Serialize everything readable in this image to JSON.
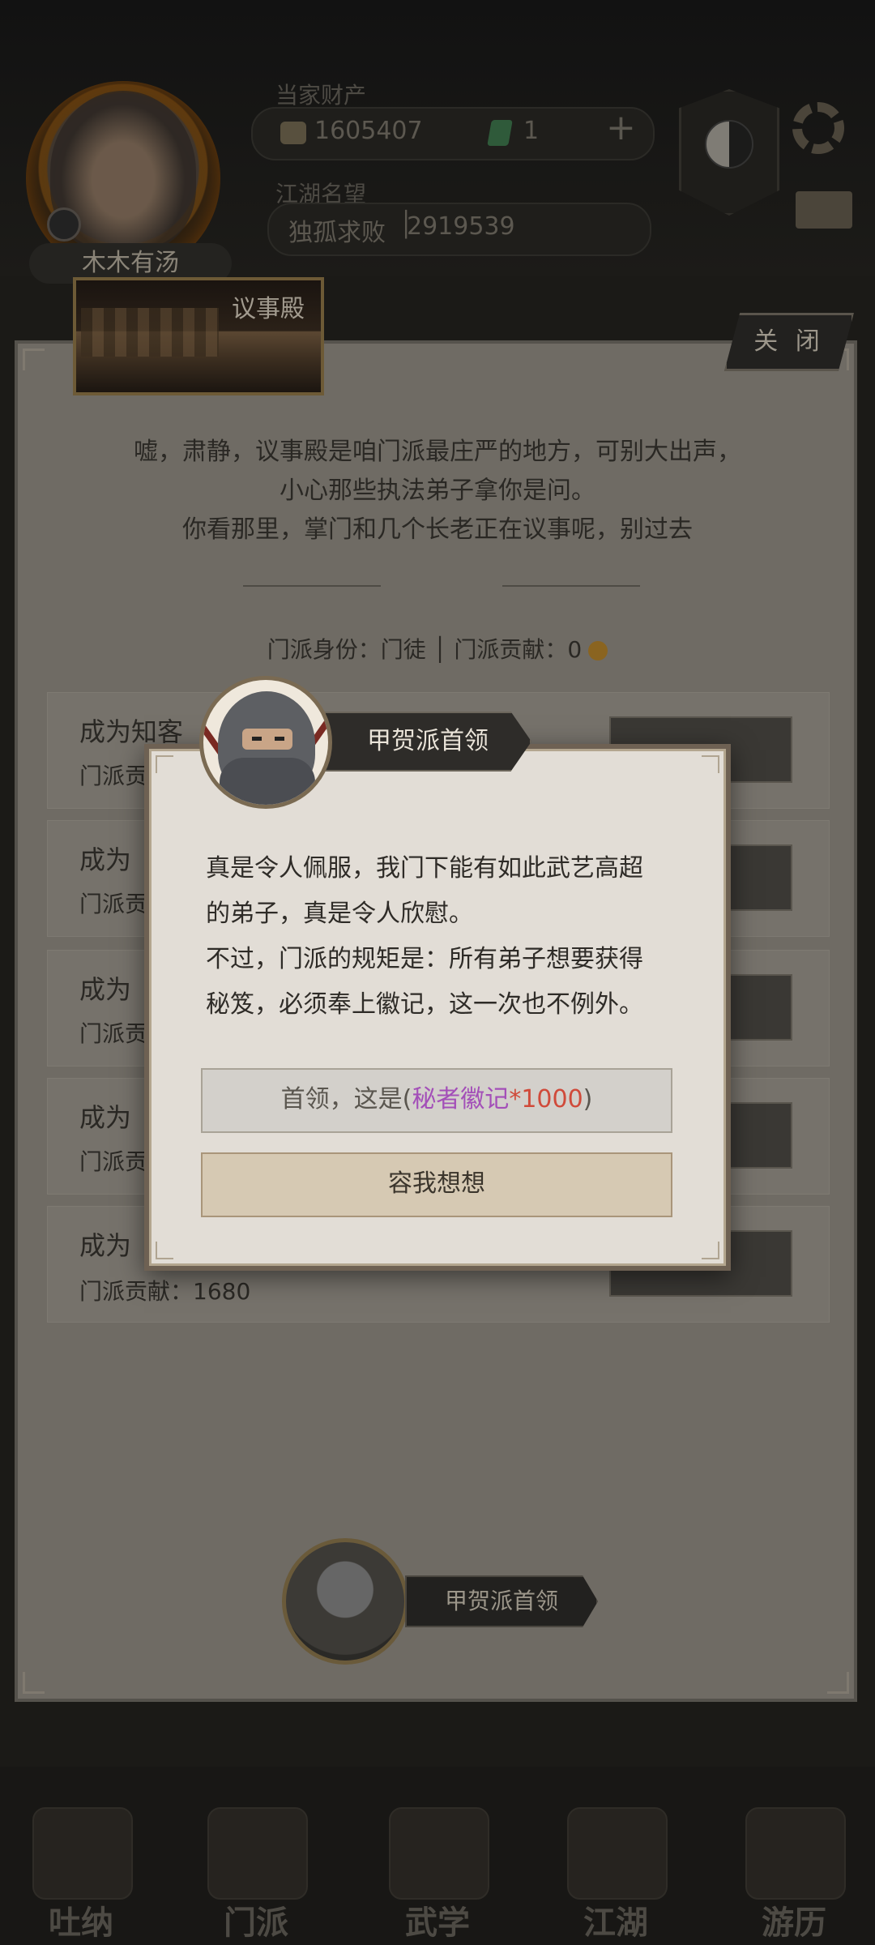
{
  "hud": {
    "player_name": "木木有汤",
    "assets_label": "当家财产",
    "gold": "1605407",
    "gems": "1",
    "reputation_label": "江湖名望",
    "title": "独孤求败",
    "reputation_value": "2919539",
    "plus": "+"
  },
  "panel": {
    "hall_title": "议事殿",
    "close_label": "关 闭",
    "intro_lines": [
      "嘘，肃静，议事殿是咱门派最庄严的地方，可别大出声，",
      "小心那些执法弟子拿你是问。",
      "你看那里，掌门和几个长老正在议事呢，别过去"
    ],
    "identity_text": "门派身份：门徒 │ 门派贡献：0",
    "rows": [
      {
        "title": "成为知客",
        "sub": "门派贡"
      },
      {
        "title": "成为",
        "sub": "门派贡"
      },
      {
        "title": "成为",
        "sub": "门派贡"
      },
      {
        "title": "成为",
        "sub": "门派贡"
      },
      {
        "title": "成为",
        "sub": "门派贡献：1680"
      }
    ],
    "speaker_name": "甲贺派首领"
  },
  "dialog": {
    "speaker": "甲贺派首领",
    "lines": [
      "真是令人佩服，我门下能有如此武艺高超",
      "的弟子，真是令人欣慰。",
      "不过，门派的规矩是：所有弟子想要获得",
      "秘笈，必须奉上徽记，这一次也不例外。"
    ],
    "choice1_prefix": "首领，这是(",
    "choice1_item": "秘者徽记",
    "choice1_count": "*1000",
    "choice1_suffix": ")",
    "choice2": "容我想想"
  },
  "nav": [
    "吐纳",
    "门派",
    "武学",
    "江湖",
    "游历"
  ],
  "colors": {
    "purple_item": "#a34fb8",
    "red_count": "#d04a3a",
    "dialog_bg": "#e2ddd6"
  }
}
